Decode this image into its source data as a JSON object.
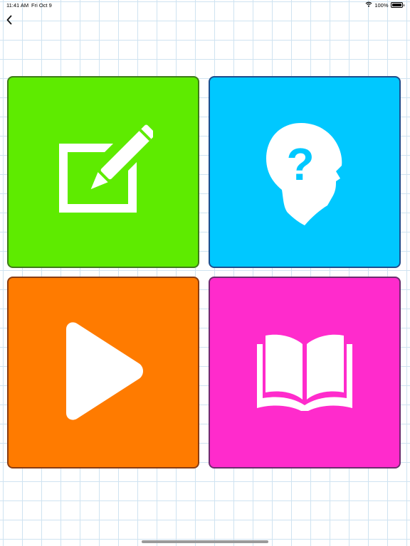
{
  "status_bar": {
    "time": "11:41 AM",
    "date": "Fri Oct 9",
    "battery": "100%",
    "wifi_icon": "wifi-icon",
    "battery_icon": "battery-icon"
  },
  "nav": {
    "back_icon": "chevron-left-icon"
  },
  "tiles": [
    {
      "id": "write",
      "icon": "edit-pencil-icon",
      "bg": "#5eeb00",
      "border": "#3f7a1a"
    },
    {
      "id": "quiz",
      "icon": "head-question-icon",
      "bg": "#00c8ff",
      "border": "#1f4d8c"
    },
    {
      "id": "play",
      "icon": "play-icon",
      "bg": "#ff7b00",
      "border": "#8a3d12"
    },
    {
      "id": "read",
      "icon": "open-book-icon",
      "bg": "#ff2bcc",
      "border": "#6e2b6e"
    }
  ],
  "colors": {
    "grid_line": "#cfe3f1",
    "icon": "#ffffff",
    "home_indicator": "#9a9a9a"
  }
}
